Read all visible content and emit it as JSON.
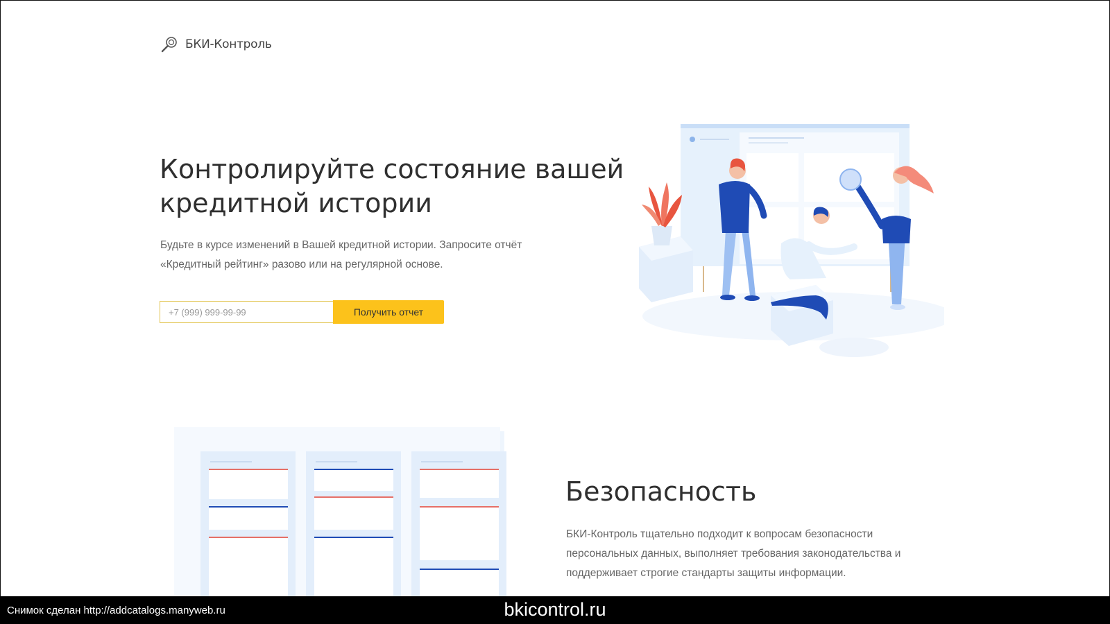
{
  "header": {
    "logo_text": "БКИ-Контроль",
    "logo_icon": "magnifier-icon"
  },
  "hero": {
    "title_line1": "Контролируйте состояние вашей",
    "title_line2": "кредитной истории",
    "desc_line1": "Будьте в курсе изменений в Вашей кредитной истории. Запросите отчёт",
    "desc_line2": "«Кредитный рейтинг» разово или на регулярной основе.",
    "phone_placeholder": "+7 (999) 999-99-99",
    "submit_label": "Получить отчет"
  },
  "security": {
    "title": "Безопасность",
    "desc_line1": "БКИ-Контроль тщательно подходит к вопросам безопасности",
    "desc_line2": "персональных данных, выполняет требования законодательства и",
    "desc_line3": "поддерживает строгие стандарты защиты информации."
  },
  "caption": {
    "left": "Снимок сделан http://addcatalogs.manyweb.ru",
    "center": "bkicontrol.ru"
  },
  "colors": {
    "accent_yellow": "#fcc21b",
    "illustration_blue": "#1f4bb5",
    "illustration_light": "#e6f1fc",
    "illustration_red": "#e8553f"
  }
}
